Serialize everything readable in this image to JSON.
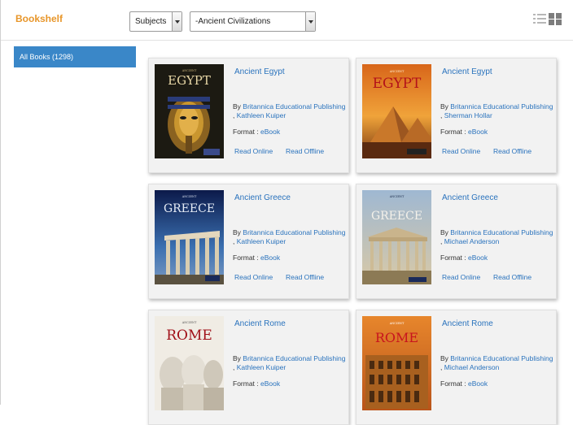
{
  "header": {
    "brand": "Bookshelf",
    "subjects_select": "Subjects",
    "category_select": "-Ancient Civilizations"
  },
  "sidebar": {
    "items": [
      {
        "label": "All Books (1298)"
      }
    ]
  },
  "labels": {
    "format": "Format :",
    "read_online": "Read Online",
    "read_offline": "Read Offline",
    "by": "By"
  },
  "books": [
    {
      "title": "Ancient Egypt",
      "publisher": "Britannica Educational Publishing",
      "author": "Kathleen Kuiper",
      "format": "eBook",
      "cover_word": "EGYPT",
      "cover_top": "ANCIENT"
    },
    {
      "title": "Ancient Egypt",
      "publisher": "Britannica Educational Publishing",
      "author": "Sherman Hollar",
      "format": "eBook",
      "cover_word": "EGYPT",
      "cover_top": "ANCIENT"
    },
    {
      "title": "Ancient Greece",
      "publisher": "Britannica Educational Publishing",
      "author": "Kathleen Kuiper",
      "format": "eBook",
      "cover_word": "GREECE",
      "cover_top": "ANCIENT"
    },
    {
      "title": "Ancient Greece",
      "publisher": "Britannica Educational Publishing",
      "author": "Michael Anderson",
      "format": "eBook",
      "cover_word": "GREECE",
      "cover_top": "ANCIENT"
    },
    {
      "title": "Ancient Rome",
      "publisher": "Britannica Educational Publishing",
      "author": "Kathleen Kuiper",
      "format": "eBook",
      "cover_word": "ROME",
      "cover_top": "ANCIENT"
    },
    {
      "title": "Ancient Rome",
      "publisher": "Britannica Educational Publishing",
      "author": "Michael Anderson",
      "format": "eBook",
      "cover_word": "ROME",
      "cover_top": "ANCIENT"
    }
  ],
  "colors": {
    "brand": "#e8962a",
    "link": "#2a73bd",
    "sidebar_active": "#3a87c8"
  },
  "icons": {
    "list_view": "list-view-icon",
    "grid_view": "grid-view-icon"
  }
}
